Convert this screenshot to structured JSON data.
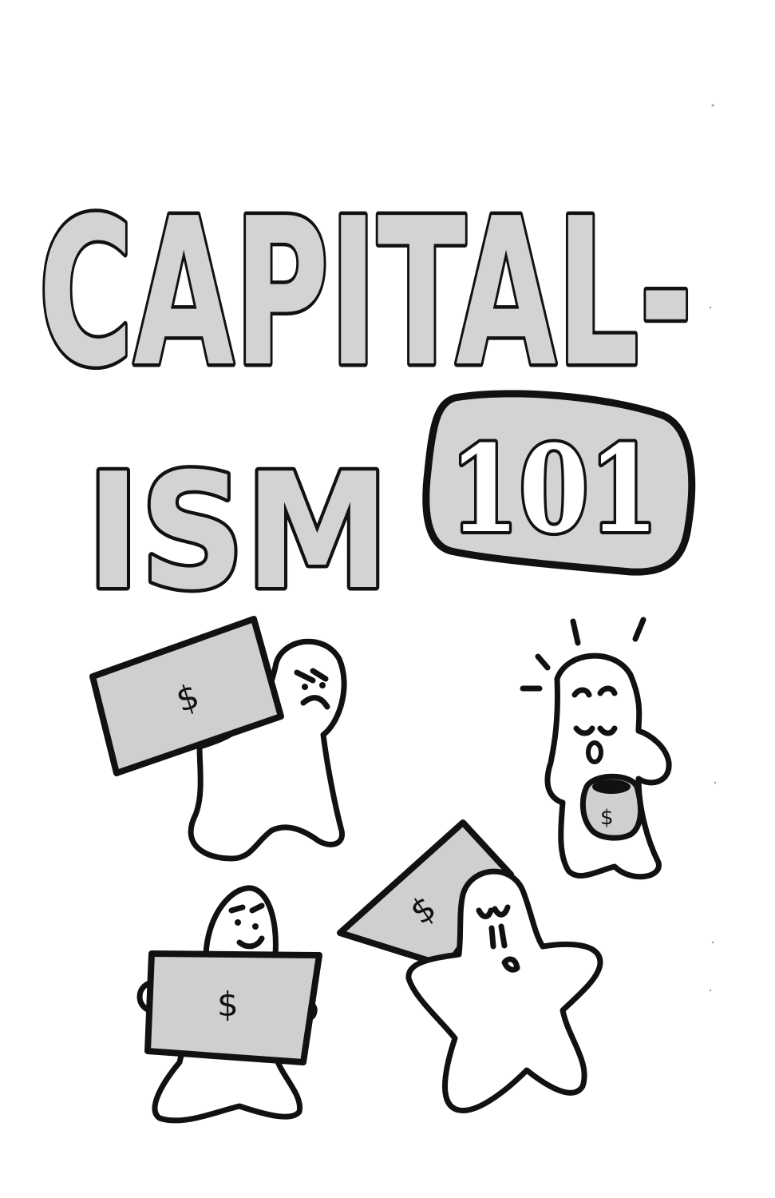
{
  "title": {
    "line1": "CAPITAL-",
    "line2": "ISM",
    "badge": "101"
  },
  "illustrations": {
    "bill_symbol": "$",
    "bag_symbol": "$"
  },
  "colors": {
    "letter_fill": "#d3d3d3",
    "ink": "#111111",
    "background": "#ffffff"
  }
}
